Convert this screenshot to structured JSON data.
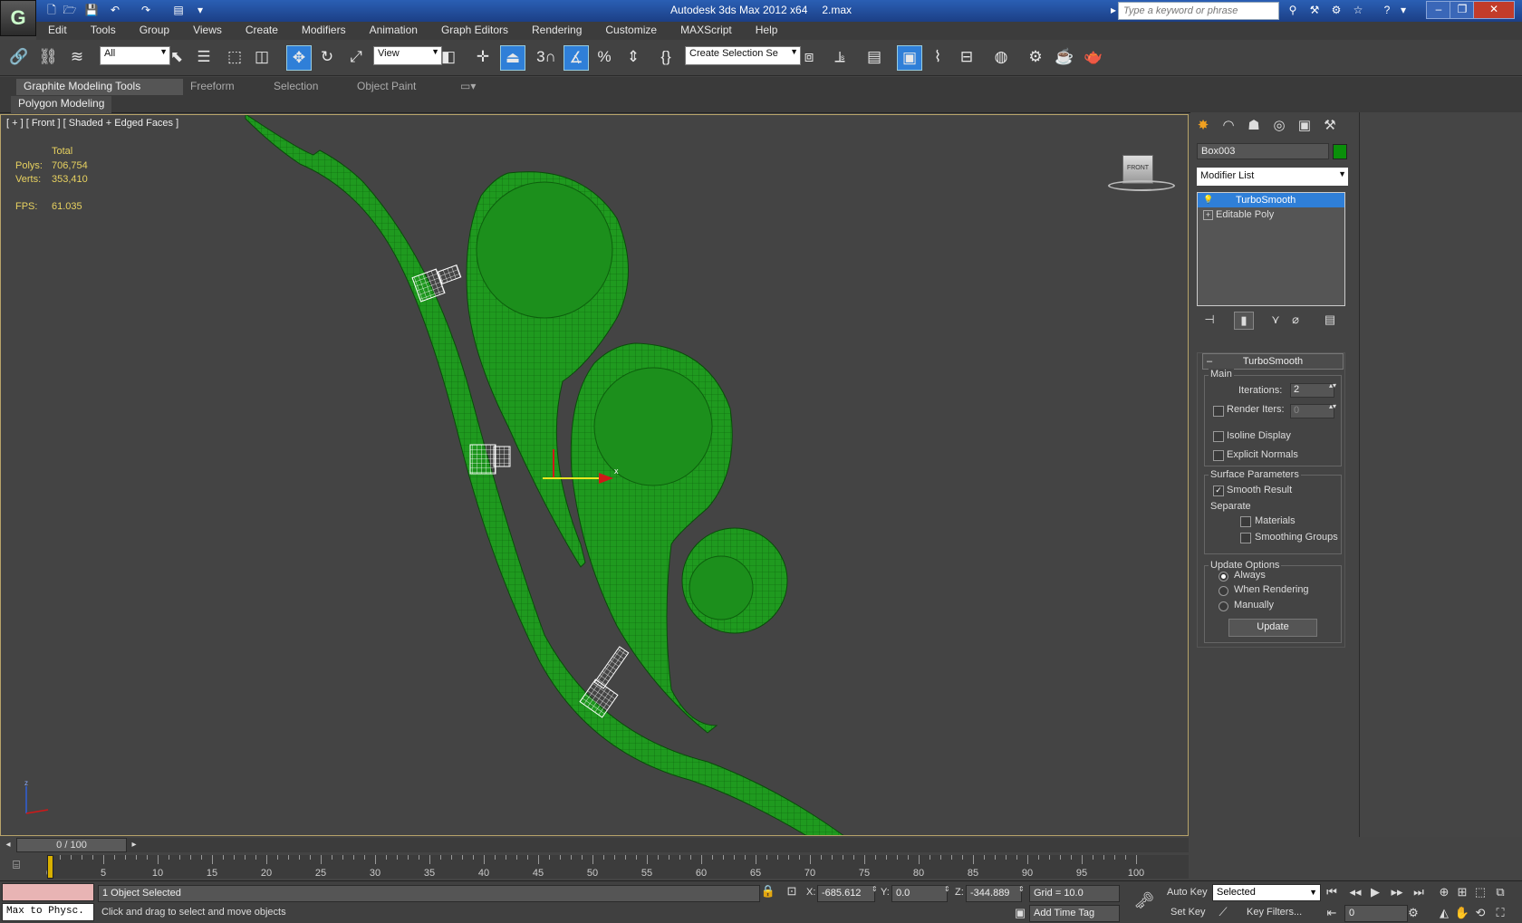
{
  "title": {
    "app": "Autodesk 3ds Max  2012 x64",
    "file": "2.max"
  },
  "search": {
    "placeholder": "Type a keyword or phrase"
  },
  "menu": [
    "Edit",
    "Tools",
    "Group",
    "Views",
    "Create",
    "Modifiers",
    "Animation",
    "Graph Editors",
    "Rendering",
    "Customize",
    "MAXScript",
    "Help"
  ],
  "toolbar": {
    "filter": "All",
    "ref_coord": "View",
    "selection_set": "Create Selection Se",
    "snap_label": "3"
  },
  "ribbon": {
    "tabs": [
      "Graphite Modeling Tools",
      "Freeform",
      "Selection",
      "Object Paint"
    ],
    "panel": "Polygon Modeling"
  },
  "viewport": {
    "label": "[ + ] [ Front ] [ Shaded + Edged Faces ]",
    "stats": {
      "header": "Total",
      "polys_label": "Polys:",
      "polys": "706,754",
      "verts_label": "Verts:",
      "verts": "353,410",
      "fps_label": "FPS:",
      "fps": "61.035"
    },
    "cube_label": "FRONT"
  },
  "command_panel": {
    "object_name": "Box003",
    "object_color": "#0a8f0a",
    "modifier_list": "Modifier List",
    "stack": [
      "TurboSmooth",
      "Editable Poly"
    ],
    "turbosmooth": {
      "title": "TurboSmooth",
      "main": "Main",
      "iterations_label": "Iterations:",
      "iterations": "2",
      "render_iters_label": "Render Iters:",
      "render_iters": "0",
      "isoline": "Isoline Display",
      "explicit": "Explicit Normals",
      "surface": "Surface Parameters",
      "smooth_result": "Smooth Result",
      "separate": "Separate",
      "materials": "Materials",
      "smoothing_groups": "Smoothing Groups",
      "update_options": "Update Options",
      "always": "Always",
      "when_rendering": "When Rendering",
      "manually": "Manually",
      "update_button": "Update"
    }
  },
  "timeline": {
    "frame": "0 / 100",
    "ticks": [
      "0",
      "5",
      "10",
      "15",
      "20",
      "25",
      "30",
      "35",
      "40",
      "45",
      "50",
      "55",
      "60",
      "65",
      "70",
      "75",
      "80",
      "85",
      "90",
      "95",
      "100"
    ]
  },
  "status": {
    "script_listener": "Max to Physc.",
    "selected": "1 Object Selected",
    "prompt": "Click and drag to select and move objects",
    "x_label": "X:",
    "x": "-685.612",
    "y_label": "Y:",
    "y": "0.0",
    "z_label": "Z:",
    "z": "-344.889",
    "grid": "Grid = 10.0",
    "add_time_tag": "Add Time Tag",
    "auto_key": "Auto Key",
    "set_key": "Set Key",
    "key_mode": "Selected",
    "key_filters": "Key Filters...",
    "current_frame": "0"
  }
}
